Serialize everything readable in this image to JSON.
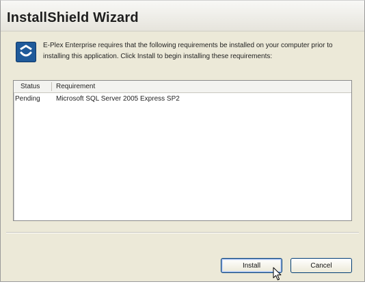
{
  "window": {
    "title": "InstallShield Wizard"
  },
  "message": {
    "text": "E-Plex Enterprise requires that the following requirements be installed on your computer prior to installing this application. Click Install to begin installing these requirements:"
  },
  "requirements": {
    "columns": [
      "Status",
      "Requirement"
    ],
    "rows": [
      {
        "status": "Pending",
        "requirement": "Microsoft SQL Server 2005 Express SP2"
      }
    ]
  },
  "buttons": {
    "install_label": "Install",
    "cancel_label": "Cancel"
  },
  "icons": {
    "info": "installer-info-icon",
    "cursor": "mouse-pointer-icon"
  },
  "colors": {
    "window_bg": "#ece9d8",
    "icon_blue": "#1f5a9a"
  }
}
